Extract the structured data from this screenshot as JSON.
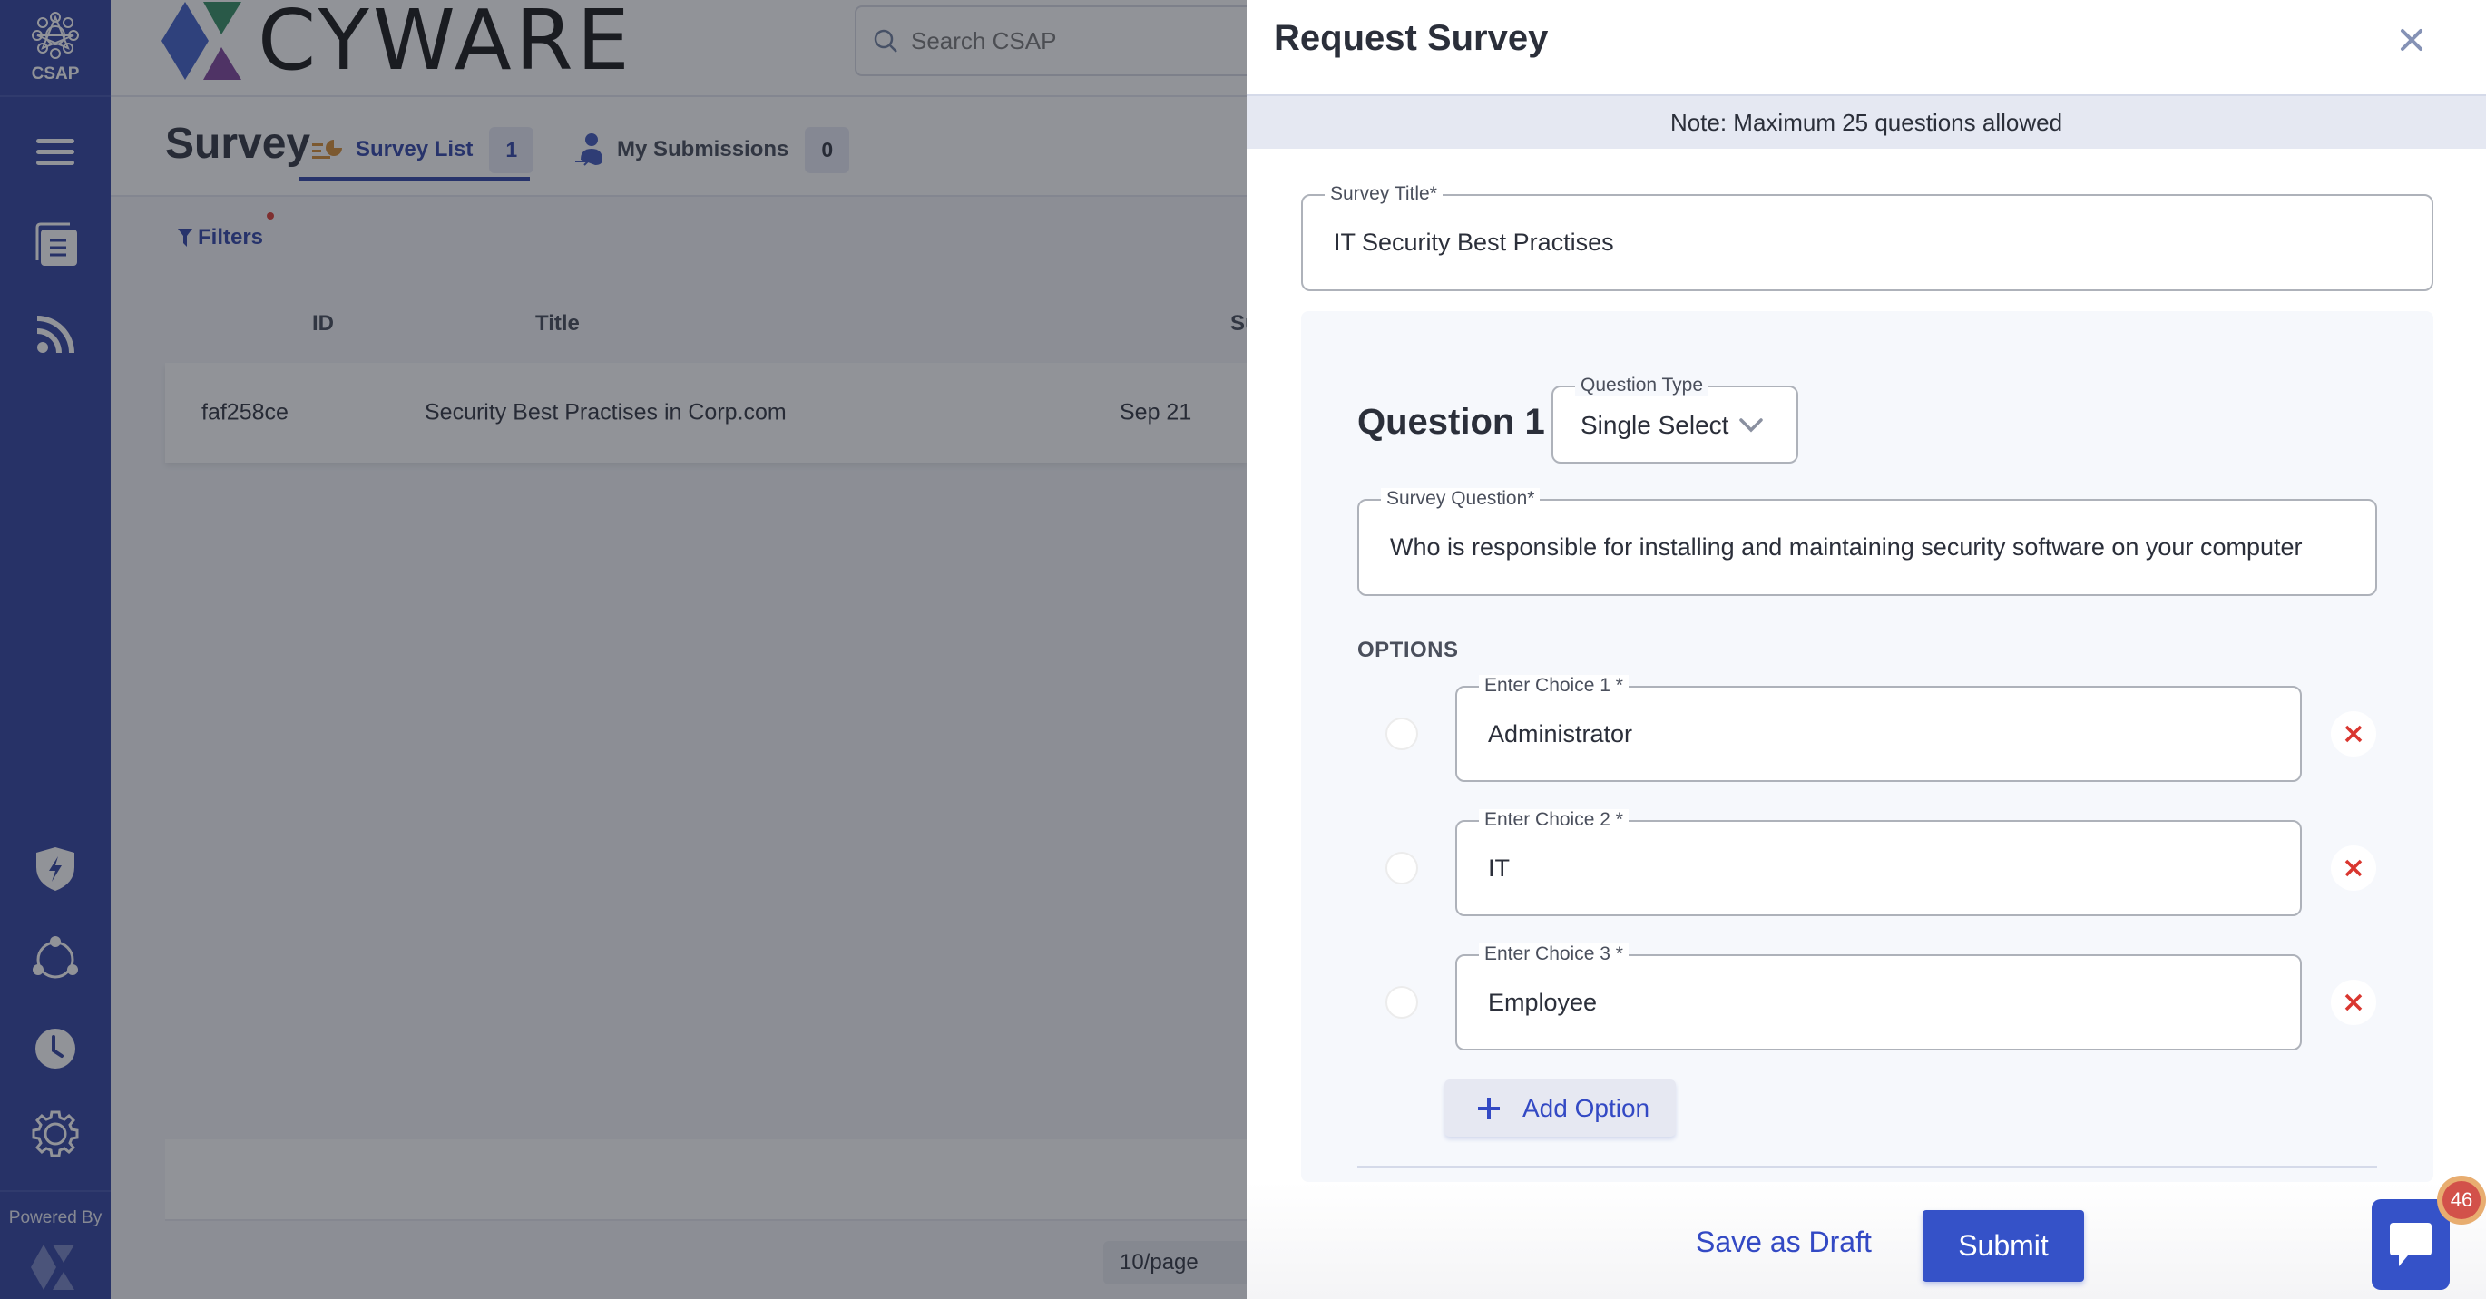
{
  "app": {
    "product_name": "CSAP",
    "logo_text": "CYWARE",
    "powered_by": "Powered By",
    "search_placeholder": "Search CSAP"
  },
  "sidebar": {
    "items": [
      {
        "icon": "menu-icon"
      },
      {
        "icon": "documents-icon"
      },
      {
        "icon": "feed-icon"
      },
      {
        "icon": "shield-bolt-icon"
      },
      {
        "icon": "share-network-icon"
      },
      {
        "icon": "clock-icon"
      },
      {
        "icon": "gear-icon"
      }
    ]
  },
  "page": {
    "title": "Survey",
    "tabs": [
      {
        "label": "Survey List",
        "count": "1",
        "active": true
      },
      {
        "label": "My Submissions",
        "count": "0",
        "active": false
      }
    ],
    "filters_label": "Filters",
    "table": {
      "columns": [
        "ID",
        "Title",
        "Survey"
      ],
      "rows": [
        {
          "id": "faf258ce",
          "title": "Security Best Practises in Corp.com",
          "survey": "Sep 21"
        }
      ]
    },
    "page_size": "10/page"
  },
  "drawer": {
    "title": "Request Survey",
    "note": "Note: Maximum 25 questions allowed",
    "survey_title": {
      "label": "Survey Title*",
      "value": "IT Security Best Practises"
    },
    "question": {
      "label": "Question 1",
      "type_label": "Question Type",
      "type_value": "Single Select",
      "question_label": "Survey Question*",
      "question_value": "Who is responsible for installing and maintaining security software on your computer",
      "options_heading": "OPTIONS",
      "choices": [
        {
          "label": "Enter Choice 1 *",
          "value": "Administrator"
        },
        {
          "label": "Enter Choice 2 *",
          "value": "IT"
        },
        {
          "label": "Enter Choice 3 *",
          "value": "Employee"
        }
      ],
      "add_option_label": "Add Option"
    },
    "footer": {
      "save_draft_label": "Save as Draft",
      "submit_label": "Submit"
    }
  },
  "chat": {
    "badge_count": "46"
  },
  "colors": {
    "sidebar": "#2b3c9c",
    "primary": "#3552c8",
    "danger": "#d9362f",
    "note_bg": "#e5e8f2"
  }
}
